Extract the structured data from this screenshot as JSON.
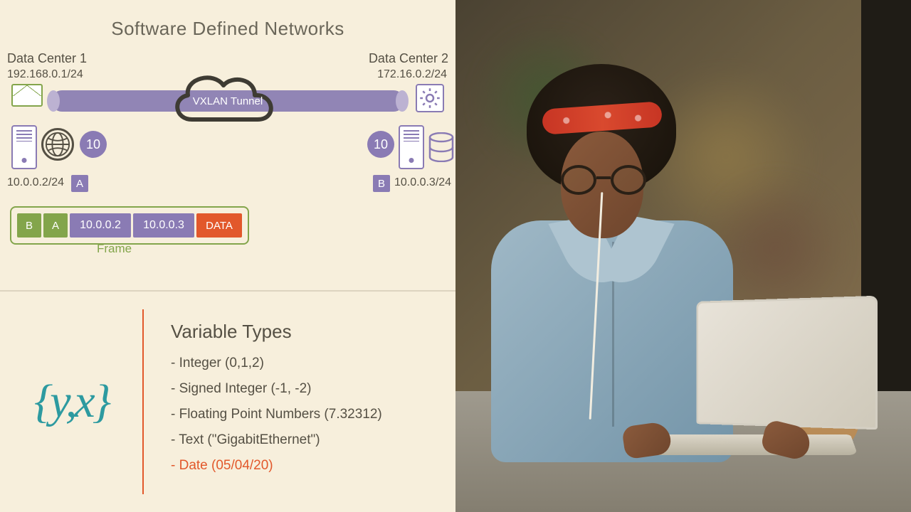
{
  "diagram": {
    "title": "Software Defined Networks",
    "dc1": {
      "label": "Data Center 1",
      "gateway_ip": "192.168.0.1/24",
      "host_ip": "10.0.0.2/24",
      "mac": "A",
      "vni": "10"
    },
    "dc2": {
      "label": "Data Center 2",
      "gateway_ip": "172.16.0.2/24",
      "host_ip": "10.0.0.3/24",
      "mac": "B",
      "vni": "10"
    },
    "tunnel_label": "VXLAN Tunnel",
    "frame": {
      "cells": [
        "B",
        "A",
        "10.0.0.2",
        "10.0.0.3",
        "DATA"
      ],
      "label": "Frame"
    }
  },
  "variables": {
    "title": "Variable Types",
    "symbol": "{y,x}",
    "items": [
      "- Integer (0,1,2)",
      "- Signed Integer (-1, -2)",
      "- Floating Point Numbers (7.32312)",
      "- Text (\"GigabitEthernet\")",
      "- Date (05/04/20)"
    ],
    "active_index": 4
  }
}
